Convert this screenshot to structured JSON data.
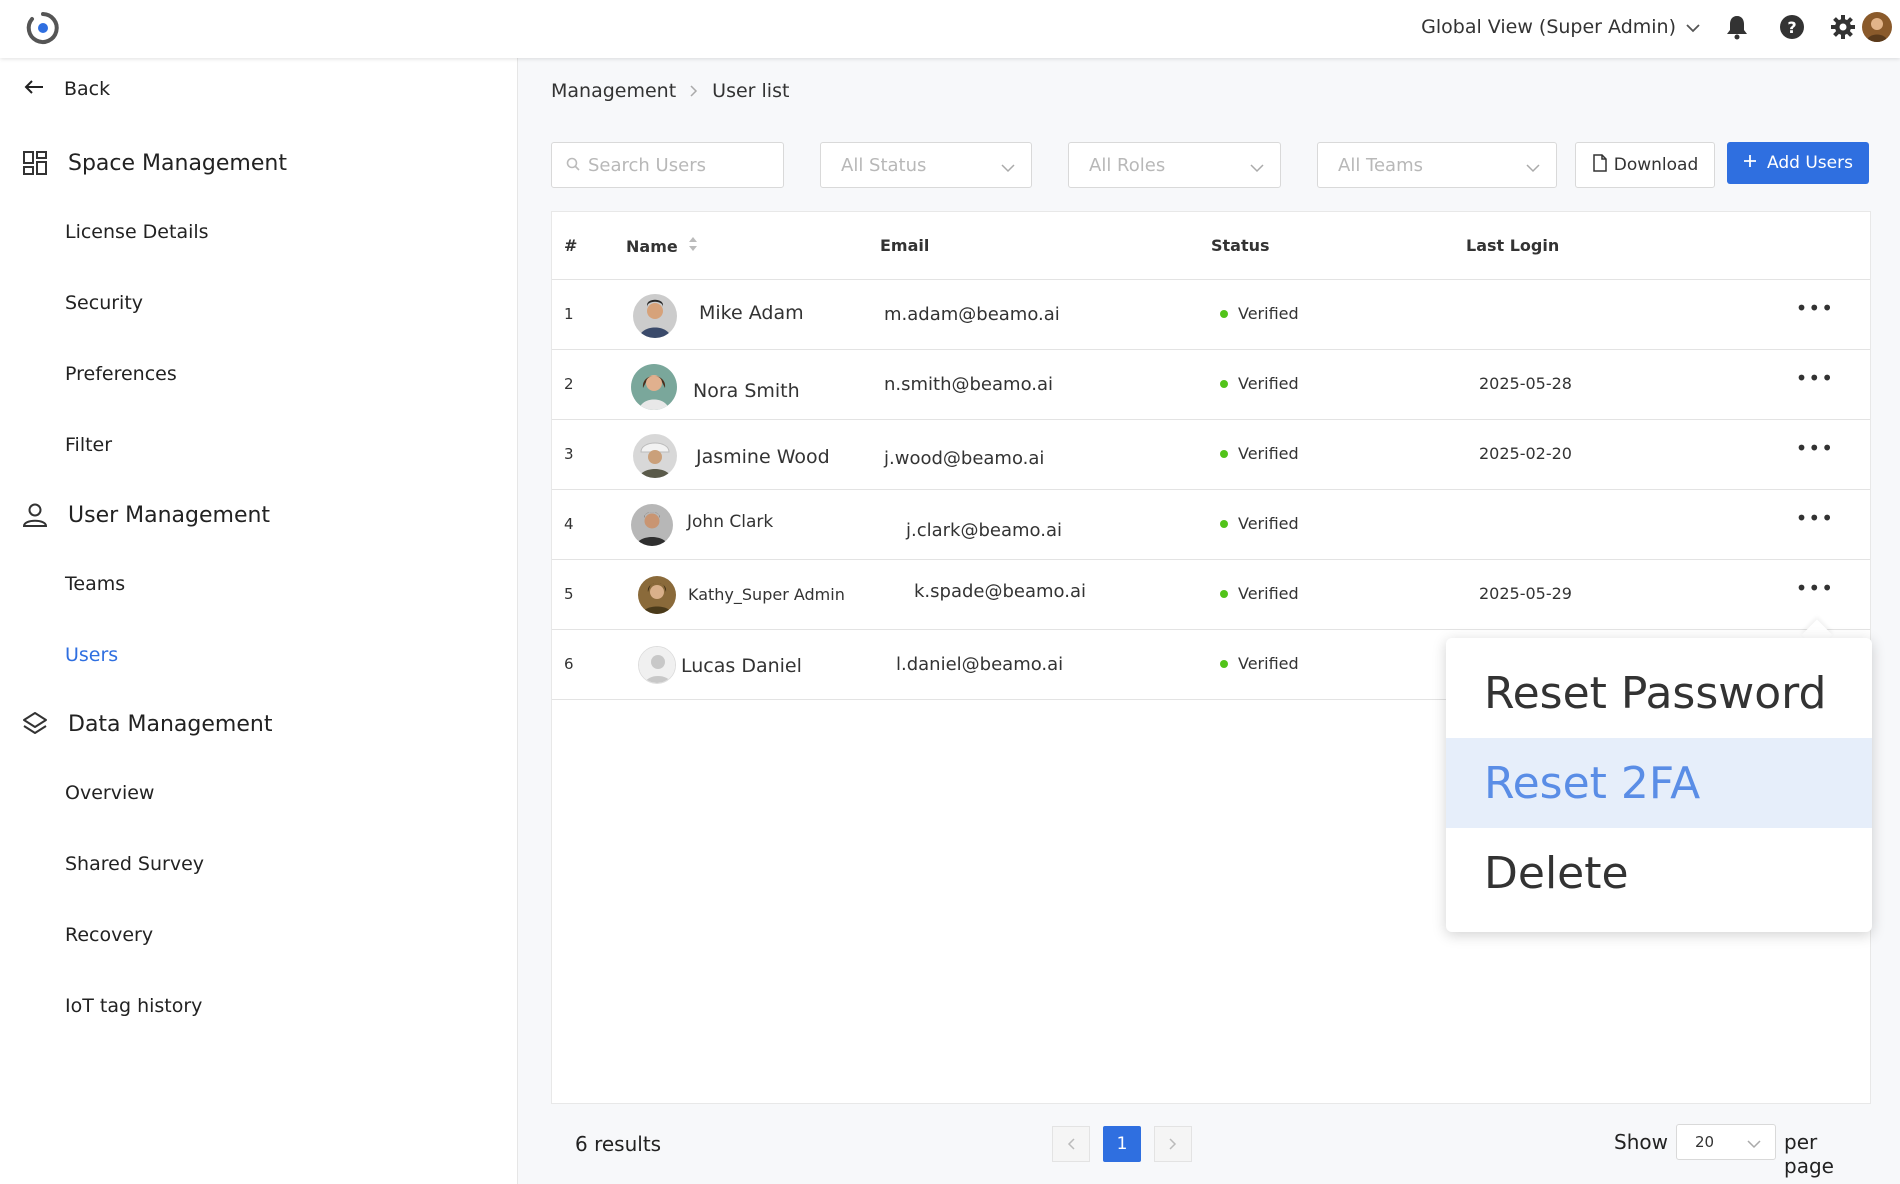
{
  "topbar": {
    "scope_label": "Global View (Super Admin)",
    "icons": [
      "bell-icon",
      "help-icon",
      "gear-icon"
    ]
  },
  "sidebar": {
    "back_label": "Back",
    "sections": [
      {
        "label": "Space Management",
        "icon": "grid-icon",
        "items": [
          "License Details",
          "Security",
          "Preferences",
          "Filter"
        ]
      },
      {
        "label": "User Management",
        "icon": "user-icon",
        "items": [
          "Teams",
          "Users"
        ]
      },
      {
        "label": "Data Management",
        "icon": "layers-icon",
        "items": [
          "Overview",
          "Shared Survey",
          "Recovery",
          "IoT tag history"
        ]
      }
    ],
    "active_item": "Users"
  },
  "breadcrumb": {
    "parent": "Management",
    "current": "User list"
  },
  "filters": {
    "search_placeholder": "Search Users",
    "status": "All Status",
    "roles": "All Roles",
    "teams": "All Teams",
    "download_label": "Download",
    "add_label": "Add Users"
  },
  "table": {
    "headers": {
      "index": "#",
      "name": "Name",
      "email": "Email",
      "status": "Status",
      "last_login": "Last Login"
    },
    "rows": [
      {
        "index": "1",
        "name": "Mike Adam",
        "email": "m.adam@beamo.ai",
        "status": "Verified",
        "last_login": ""
      },
      {
        "index": "2",
        "name": "Nora Smith",
        "email": "n.smith@beamo.ai",
        "status": "Verified",
        "last_login": "2025-05-28"
      },
      {
        "index": "3",
        "name": "Jasmine Wood",
        "email": "j.wood@beamo.ai",
        "status": "Verified",
        "last_login": "2025-02-20"
      },
      {
        "index": "4",
        "name": "John Clark",
        "email": "j.clark@beamo.ai",
        "status": "Verified",
        "last_login": ""
      },
      {
        "index": "5",
        "name": "Kathy_Super Admin",
        "email": "k.spade@beamo.ai",
        "status": "Verified",
        "last_login": "2025-05-29"
      },
      {
        "index": "6",
        "name": "Lucas Daniel",
        "email": "l.daniel@beamo.ai",
        "status": "Verified",
        "last_login": ""
      }
    ]
  },
  "footer": {
    "results": "6 results",
    "current_page": "1",
    "show_label": "Show",
    "per_page_value": "20",
    "per_page_label": "per page"
  },
  "context_menu": {
    "items": [
      "Reset Password",
      "Reset 2FA",
      "Delete"
    ],
    "highlighted": "Reset 2FA"
  },
  "colors": {
    "accent": "#2f6fe0",
    "verified": "#52c41a",
    "menu_highlight": "#e6eefa"
  }
}
